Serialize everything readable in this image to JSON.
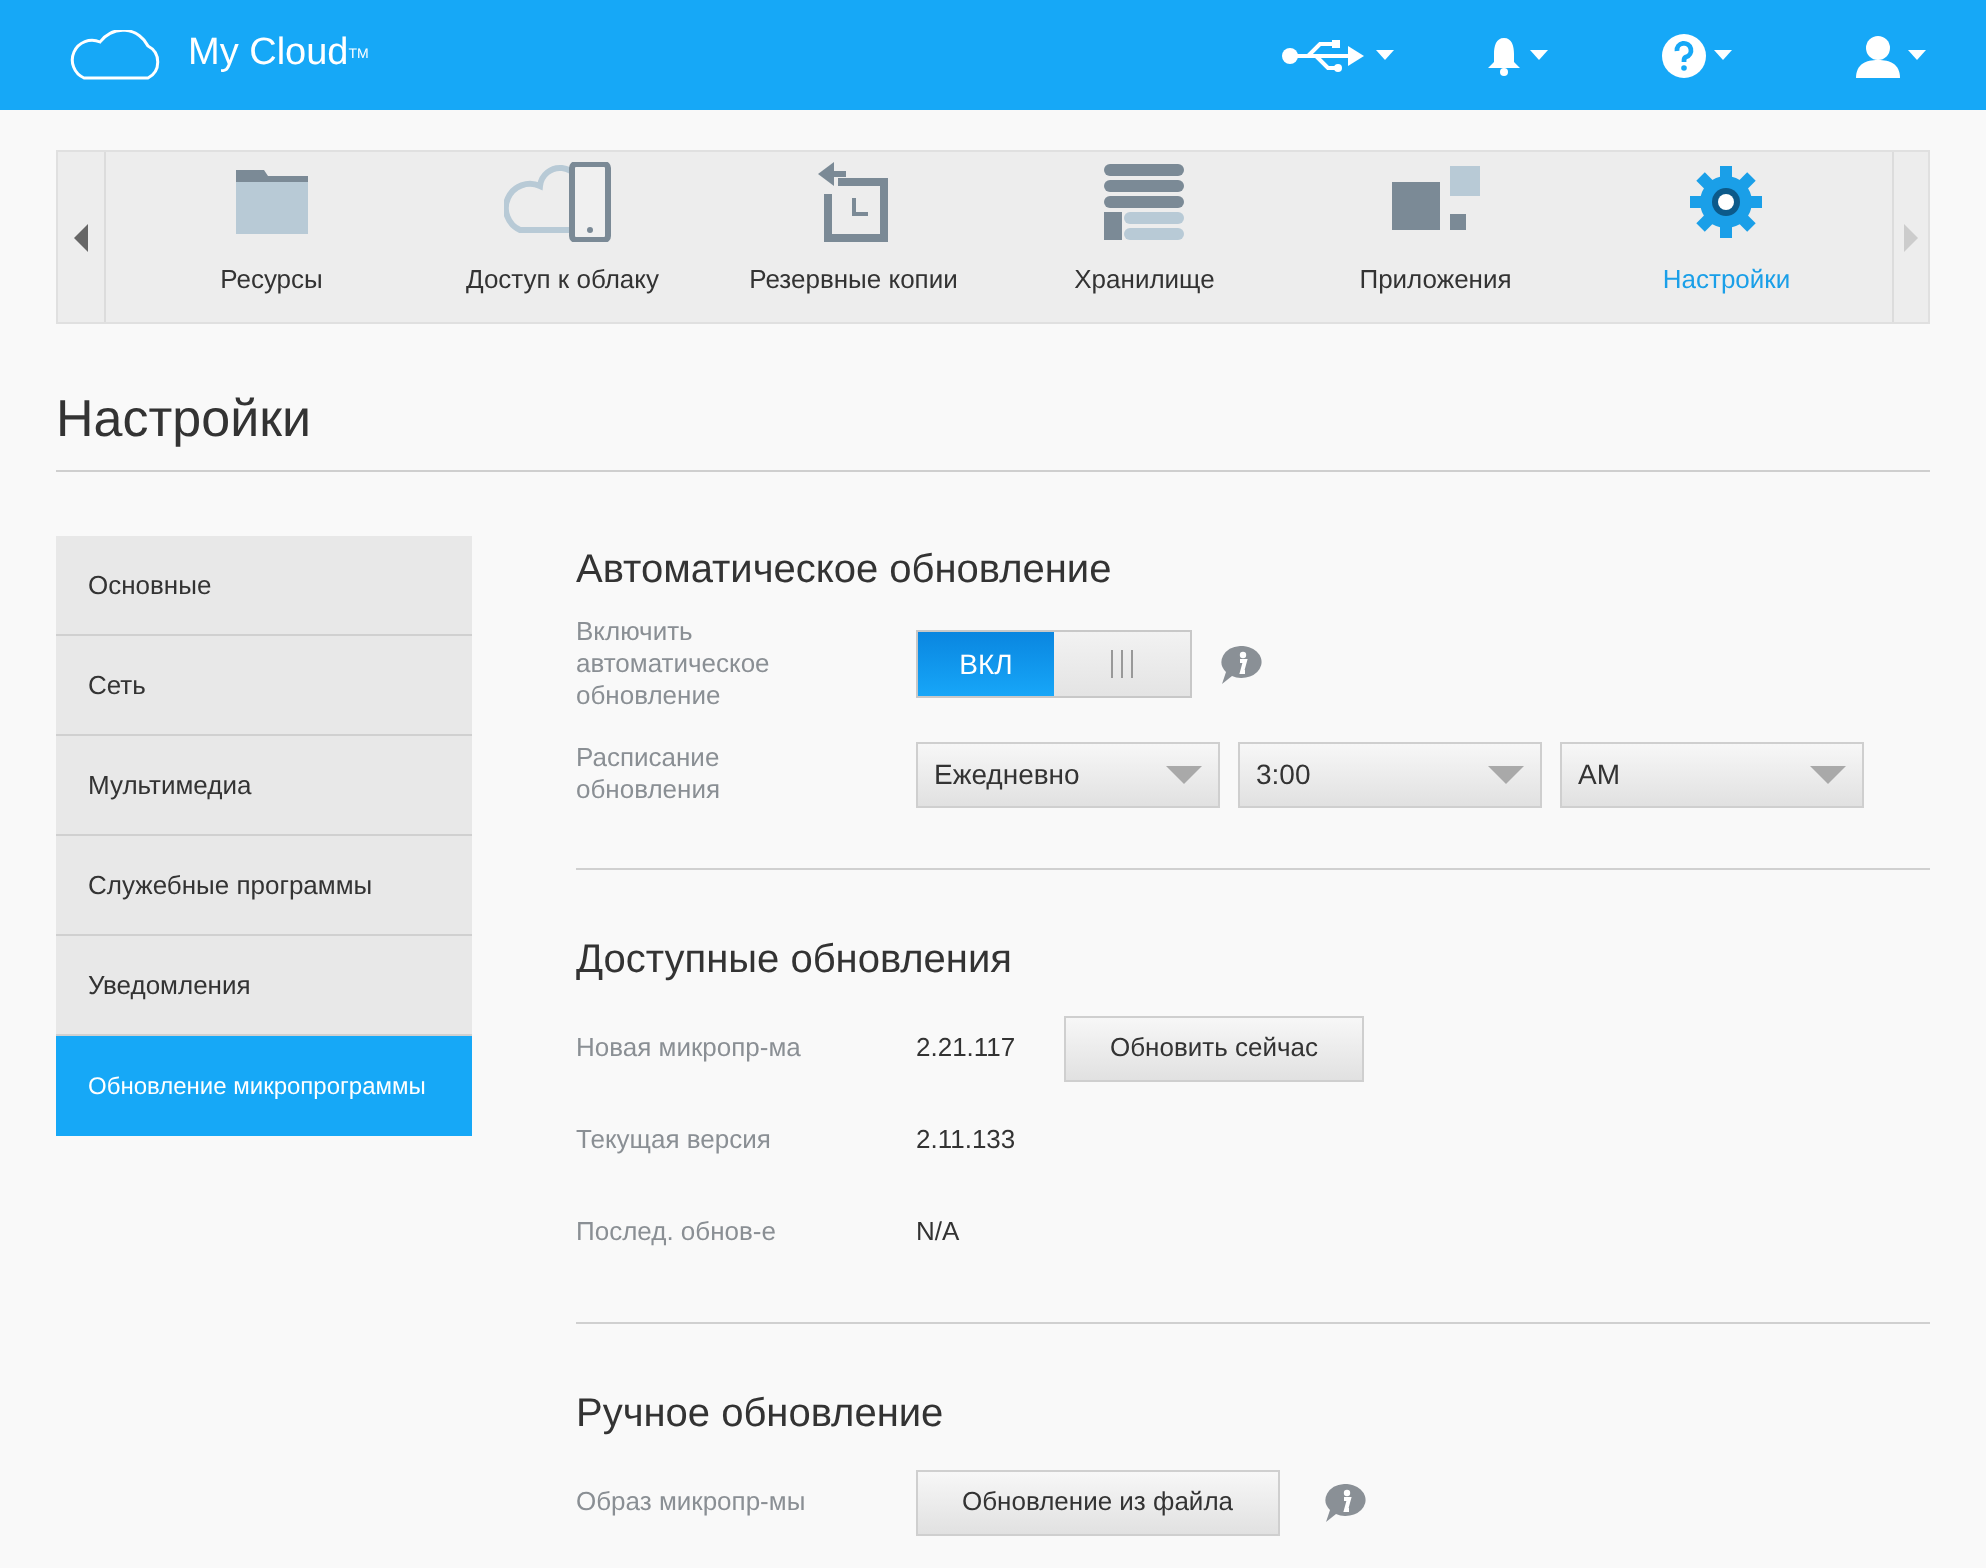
{
  "header": {
    "logo": "My Cloud$^{TM}$"
  },
  "nav": {
    "items": [
      {
        "label": "Ресурсы",
        "selected": false
      },
      {
        "label": "Доступ к облаку",
        "selected": false
      },
      {
        "label": "Резервные копии",
        "selected": false
      },
      {
        "label": "Хранилище",
        "selected": false
      },
      {
        "label": "Приложения",
        "selected": false
      },
      {
        "label": "Настройки",
        "selected": true
      }
    ]
  },
  "page_title": "Настройки",
  "sidebar": {
    "items": [
      {
        "label": "Основные",
        "selected": false
      },
      {
        "label": "Сеть",
        "selected": false
      },
      {
        "label": "Мультимедиа",
        "selected": false
      },
      {
        "label": "Служебные программы",
        "selected": false
      },
      {
        "label": "Уведомления",
        "selected": false
      },
      {
        "label": "Обновление микропрограммы",
        "selected": true
      }
    ]
  },
  "sections": [
    {
      "title": "Автоматическое обновление",
      "rows": [
        {
          "kind": "toggle",
          "label": "Включить автоматическое обновление",
          "on": true,
          "on_label": "ВКЛ",
          "info": true
        },
        {
          "kind": "selects",
          "label": "Расписание обновления",
          "values": [
            "Ежедневно",
            "3:00",
            "AM"
          ]
        }
      ]
    },
    {
      "title": "Доступные обновления",
      "rows": [
        {
          "kind": "value",
          "label": "Новая микропр-ма",
          "value": "2.21.117",
          "button": "Обновить сейчас"
        },
        {
          "kind": "value",
          "label": "Текущая версия",
          "value": "2.11.133"
        },
        {
          "kind": "value",
          "label": "Послед. обнов-е",
          "value": "N/A"
        }
      ]
    },
    {
      "title": "Ручное обновление",
      "rows": [
        {
          "kind": "button",
          "label": "Образ микропр-мы",
          "button": "Обновление из файла",
          "info": true
        }
      ]
    }
  ]
}
